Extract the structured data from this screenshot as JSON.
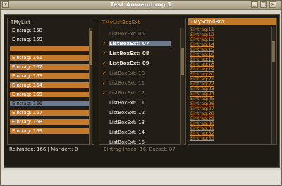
{
  "window": {
    "title": "Test Anwendung 1"
  },
  "panel1": {
    "title": "TMyList",
    "items": [
      {
        "label": "Eintrag: 158",
        "state": "normal"
      },
      {
        "label": "Eintrag: 159",
        "state": "normal"
      },
      {
        "label": "",
        "state": "hl"
      },
      {
        "label": "Eintrag: 161",
        "state": "hl"
      },
      {
        "label": "Eintrag: 162",
        "state": "hl"
      },
      {
        "label": "Eintrag: 163",
        "state": "hl"
      },
      {
        "label": "Eintrag: 164",
        "state": "hl"
      },
      {
        "label": "Eintrag: 165",
        "state": "hl"
      },
      {
        "label": "Eintrag: 166",
        "state": "sel"
      },
      {
        "label": "Eintrag: 167",
        "state": "hl"
      },
      {
        "label": "Eintrag: 168",
        "state": "hl"
      },
      {
        "label": "Eintrag: 169",
        "state": "hl"
      }
    ],
    "status": "Reihindex: 166 | Markiert: 0"
  },
  "panel2": {
    "title": "TMyListBoxExt",
    "items": [
      {
        "label": "ListBoxExt: 05",
        "style": "dim",
        "checked": false
      },
      {
        "label": "ListBoxExt: 07",
        "style": "sel",
        "checked": true
      },
      {
        "label": "ListBoxExt: 08",
        "style": "bold",
        "checked": true
      },
      {
        "label": "ListBoxExt: 09",
        "style": "bold",
        "checked": true
      },
      {
        "label": "ListBoxExt: 10",
        "style": "dim",
        "checked": true
      },
      {
        "label": "ListBoxExt: 11",
        "style": "dim",
        "checked": true
      },
      {
        "label": "ListBoxExt: 12",
        "style": "dim",
        "checked": true
      },
      {
        "label": "ListBoxExt: 11",
        "style": "plain",
        "checked": false
      },
      {
        "label": "ListBoxExt: 12",
        "style": "plain",
        "checked": false
      },
      {
        "label": "ListBoxExt: 13",
        "style": "plain",
        "checked": false
      },
      {
        "label": "ListBoxExt: 14",
        "style": "plain",
        "checked": false
      },
      {
        "label": "ListBoxExt: 15",
        "style": "plain",
        "checked": false
      }
    ],
    "status": "Eintrag Index: 16, Buzset: 07"
  },
  "panel3": {
    "title": "TMyScrollBox",
    "items": [
      "Eintrag:11",
      "Eintrag:12",
      "Eintrag:13",
      "Eintrag:14",
      "Eintrag:15",
      "Eintrag:16",
      "Eintrag:17",
      "Eintrag:18",
      "Eintrag:19",
      "Eintrag:20",
      "Eintrag:21",
      "Eintrag:22",
      "Eintrag:23",
      "Eintrag:24",
      "Eintrag:25",
      "Eintrag:26",
      "Eintrag:27",
      "Eintrag:28",
      "Eintrag:29",
      "Eintrag:30",
      "Eintrag:31",
      "Eintrag:32",
      "Eintrag:33"
    ]
  },
  "colors": {
    "accent": "#c47a2d",
    "selection": "#6e7b8e",
    "background": "#1e1a14"
  }
}
